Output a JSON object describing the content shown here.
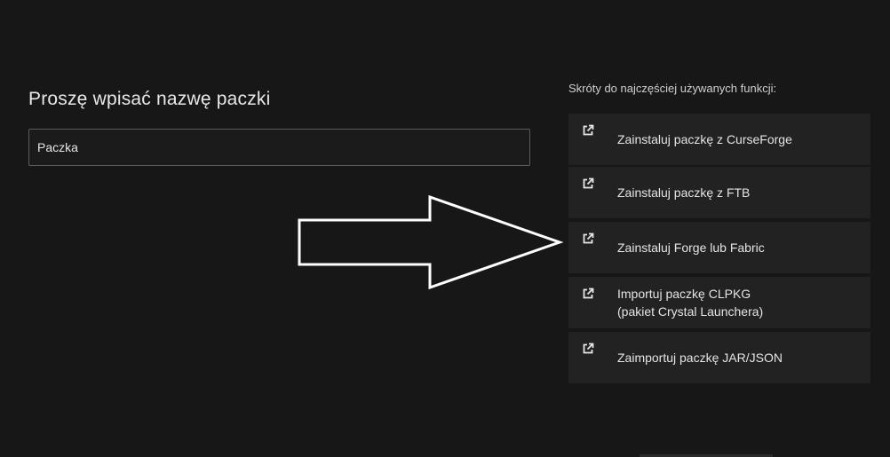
{
  "form": {
    "title": "Proszę wpisać nazwę paczki",
    "name_value": "Paczka"
  },
  "shortcuts": {
    "heading": "Skróty do najczęściej używanych funkcji:",
    "items": [
      {
        "icon": "external-link-icon",
        "line1": "Zainstaluj paczkę z CurseForge",
        "line2": ""
      },
      {
        "icon": "external-link-icon",
        "line1": "Zainstaluj paczkę z FTB",
        "line2": ""
      },
      {
        "icon": "external-link-icon",
        "line1": "Zainstaluj Forge lub Fabric",
        "line2": ""
      },
      {
        "icon": "external-link-icon",
        "line1": "Importuj paczkę CLPKG",
        "line2": "(pakiet Crystal Launchera)"
      },
      {
        "icon": "external-link-icon",
        "line1": "Zaimportuj paczkę JAR/JSON",
        "line2": ""
      }
    ]
  },
  "colors": {
    "background": "#171717",
    "card": "#222222",
    "input_border": "#5b5b5b",
    "arrow_stroke": "#ffffff"
  }
}
